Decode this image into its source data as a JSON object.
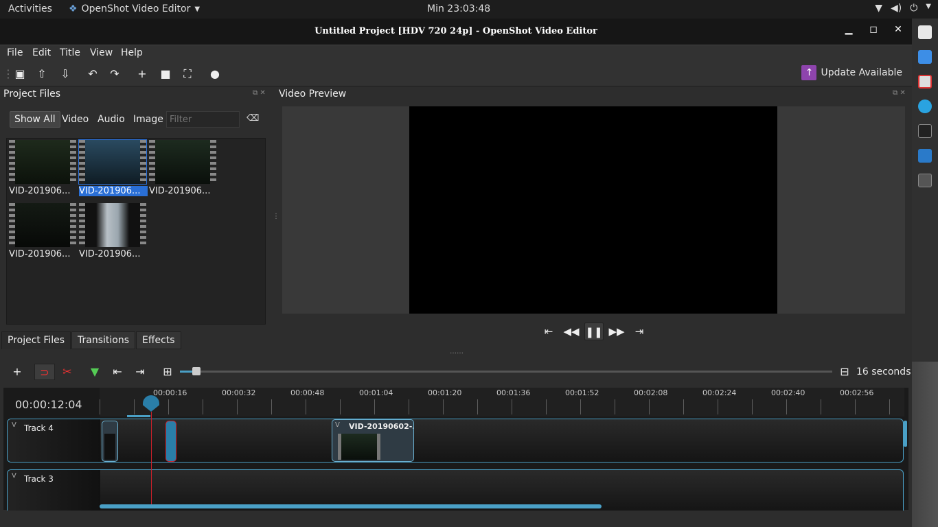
{
  "topbar": {
    "activities": "Activities",
    "app_name": "OpenShot Video Editor",
    "clock": "Min 23:03:48"
  },
  "window": {
    "title": "Untitled Project [HDV 720 24p] - OpenShot Video Editor"
  },
  "menu": {
    "items": [
      "File",
      "Edit",
      "Title",
      "View",
      "Help"
    ]
  },
  "toolbar": {
    "update_label": "Update Available",
    "update_color": "#8e44ad"
  },
  "project_files": {
    "title": "Project Files",
    "filters": [
      "Show All",
      "Video",
      "Audio",
      "Image"
    ],
    "filter_placeholder": "Filter",
    "files": [
      {
        "name": "VID-201906...",
        "selected": false
      },
      {
        "name": "VID-201906...",
        "selected": true
      },
      {
        "name": "VID-201906...",
        "selected": false
      },
      {
        "name": "VID-201906...",
        "selected": false
      },
      {
        "name": "VID-201906...",
        "selected": false
      }
    ]
  },
  "tabs": [
    "Project Files",
    "Transitions",
    "Effects"
  ],
  "preview": {
    "title": "Video Preview"
  },
  "timeline": {
    "zoom_label": "16 seconds",
    "current_time": "00:00:12:04",
    "ticks": [
      "00:00:16",
      "00:00:32",
      "00:00:48",
      "00:01:04",
      "00:01:20",
      "00:01:36",
      "00:01:52",
      "00:02:08",
      "00:02:24",
      "00:02:40",
      "00:02:56"
    ],
    "tracks": [
      {
        "name": "Track 4"
      },
      {
        "name": "Track 3"
      }
    ],
    "clip_title": "VID-20190602-..."
  },
  "colors": {
    "accent": "#4aa0c6",
    "selection": "#2a6fd6",
    "playhead": "#d0202a"
  }
}
